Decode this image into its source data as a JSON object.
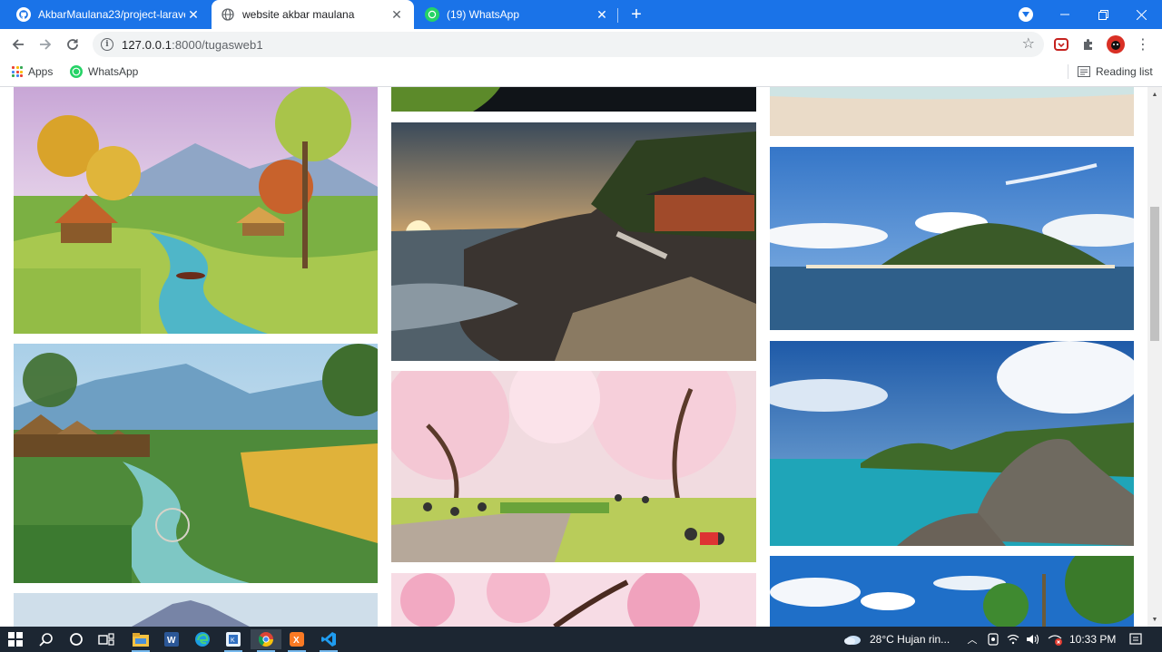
{
  "browser": {
    "tabs": [
      {
        "title": "AkbarMaulana23/project-laravel",
        "favicon": "github-icon",
        "active": false
      },
      {
        "title": "website akbar maulana",
        "favicon": "globe-icon",
        "active": true
      },
      {
        "title": "(19) WhatsApp",
        "favicon": "whatsapp-icon",
        "active": false
      }
    ],
    "new_tab_label": "+",
    "url_host": "127.0.0.1",
    "url_path": ":8000/tugasweb1",
    "bookmarks": [
      {
        "label": "Apps",
        "icon": "apps-grid-icon"
      },
      {
        "label": "WhatsApp",
        "icon": "whatsapp-icon"
      }
    ],
    "reading_list_label": "Reading list",
    "colors": {
      "tabstrip": "#1a73e8",
      "whatsapp": "#25d366"
    }
  },
  "gallery": {
    "images": [
      {
        "name": "painting-village-river-top",
        "column": 1,
        "subject": "painted landscape with thatched huts by a river and boat"
      },
      {
        "name": "painting-village-rice-field",
        "column": 1,
        "subject": "painted village with rice field and fisherman in stream"
      },
      {
        "name": "painting-mountain-partial",
        "column": 1,
        "subject": "painting of mountain (partially visible)"
      },
      {
        "name": "grass-partial-top",
        "column": 2,
        "subject": "grass scene (partially visible)"
      },
      {
        "name": "coastal-temple-sunset",
        "column": 2,
        "subject": "temple on rocky coast at sunset"
      },
      {
        "name": "cherry-blossom-park",
        "column": 2,
        "subject": "people picnicking under cherry blossoms"
      },
      {
        "name": "cherry-blossom-branches",
        "column": 2,
        "subject": "pink cherry blossom branches (partially visible)"
      },
      {
        "name": "beach-sand-partial",
        "column": 3,
        "subject": "sandy beach (partially visible)"
      },
      {
        "name": "tropical-island",
        "column": 3,
        "subject": "green island surrounded by sea"
      },
      {
        "name": "komodo-lagoon",
        "column": 3,
        "subject": "komodo dragon on rocks above turquoise lagoon"
      },
      {
        "name": "palm-beach-partial",
        "column": 3,
        "subject": "palm trees under blue sky (partially visible)"
      }
    ]
  },
  "taskbar": {
    "weather": "28°C  Hujan rin...",
    "time": "10:33 PM",
    "apps": [
      "start-icon",
      "search-icon",
      "cortana-icon",
      "task-view-icon",
      "file-explorer-icon",
      "word-icon",
      "edge-icon",
      "app-icon",
      "chrome-icon",
      "xampp-icon",
      "vscode-icon"
    ]
  }
}
